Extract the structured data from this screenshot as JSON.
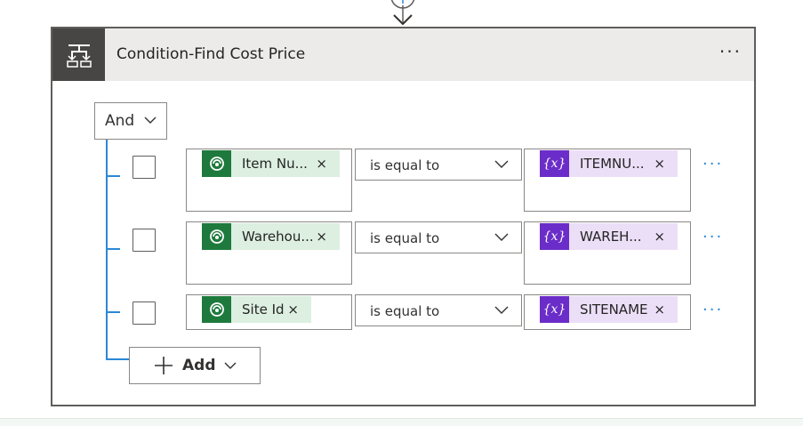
{
  "card": {
    "title": "Condition-Find Cost Price",
    "more_label": "···",
    "icon": "condition-icon"
  },
  "group": {
    "operator": "And"
  },
  "rows": [
    {
      "left_token": {
        "label": "Item Nu...",
        "icon": "dataverse-icon",
        "color": "#1e7a3c"
      },
      "operator": "is equal to",
      "right_token": {
        "label": "ITEMNU...",
        "icon": "variable-icon",
        "color": "#6b2dc9"
      },
      "more_label": "···"
    },
    {
      "left_token": {
        "label": "Warehou...",
        "icon": "dataverse-icon",
        "color": "#1e7a3c"
      },
      "operator": "is equal to",
      "right_token": {
        "label": "WAREH...",
        "icon": "variable-icon",
        "color": "#6b2dc9"
      },
      "more_label": "···"
    },
    {
      "left_token": {
        "label": "Site Id",
        "icon": "dataverse-icon",
        "color": "#1e7a3c"
      },
      "operator": "is equal to",
      "right_token": {
        "label": "SITENAME",
        "icon": "variable-icon",
        "color": "#6b2dc9"
      },
      "more_label": "···"
    }
  ],
  "token_remove_label": "×",
  "variable_glyph": "{x}",
  "add_button": {
    "label": "Add"
  },
  "colors": {
    "accent": "#2b88d8",
    "header_bg": "#edebe9",
    "icon_box": "#484644"
  }
}
